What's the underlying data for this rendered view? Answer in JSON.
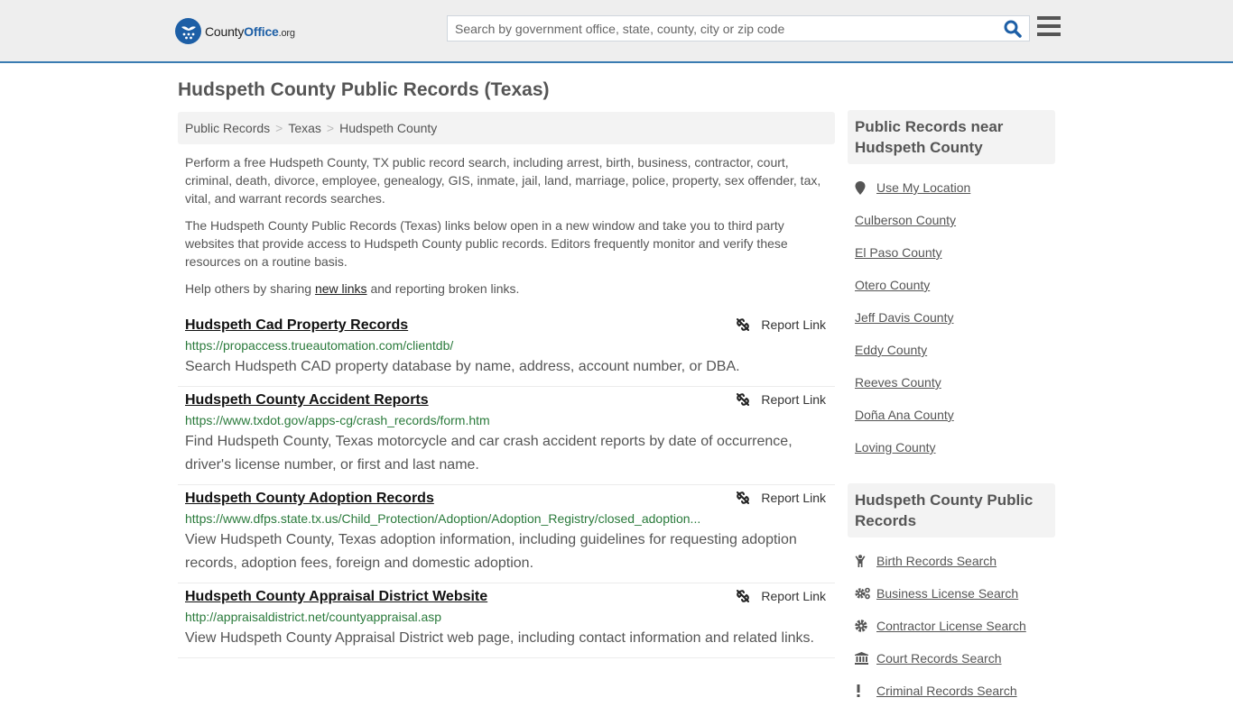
{
  "header": {
    "logo": {
      "part1": "County",
      "part2": "Office",
      "part3": ".org"
    },
    "search_placeholder": "Search by government office, state, county, city or zip code",
    "search_value": "",
    "search_icon": "search-icon",
    "menu_icon": "hamburger-menu-icon",
    "accent_color": "#3a7cb2"
  },
  "page": {
    "title": "Hudspeth County Public Records (Texas)",
    "breadcrumb": [
      "Public Records",
      "Texas",
      "Hudspeth County"
    ],
    "intro": {
      "p1": "Perform a free Hudspeth County, TX public record search, including arrest, birth, business, contractor, court, criminal, death, divorce, employee, genealogy, GIS, inmate, jail, land, marriage, police, property, sex offender, tax, vital, and warrant records searches.",
      "p2": "The Hudspeth County Public Records (Texas) links below open in a new window and take you to third party websites that provide access to Hudspeth County public records. Editors frequently monitor and verify these resources on a routine basis.",
      "p3_before": "Help others by sharing ",
      "p3_link": "new links",
      "p3_after": " and reporting broken links."
    }
  },
  "records": [
    {
      "title": "Hudspeth Cad Property Records",
      "url": "https://propaccess.trueautomation.com/clientdb/",
      "description": "Search Hudspeth CAD property database by name, address, account number, or DBA.",
      "report_label": "Report Link"
    },
    {
      "title": "Hudspeth County Accident Reports",
      "url": "https://www.txdot.gov/apps-cg/crash_records/form.htm",
      "description": "Find Hudspeth County, Texas motorcycle and car crash accident reports by date of occurrence, driver's license number, or first and last name.",
      "report_label": "Report Link"
    },
    {
      "title": "Hudspeth County Adoption Records",
      "url": "https://www.dfps.state.tx.us/Child_Protection/Adoption/Adoption_Registry/closed_adoption...",
      "description": "View Hudspeth County, Texas adoption information, including guidelines for requesting adoption records, adoption fees, foreign and domestic adoption.",
      "report_label": "Report Link"
    },
    {
      "title": "Hudspeth County Appraisal District Website",
      "url": "http://appraisaldistrict.net/countyappraisal.asp",
      "description": "View Hudspeth County Appraisal District web page, including contact information and related links.",
      "report_label": "Report Link"
    }
  ],
  "sidebar": {
    "nearby": {
      "heading": "Public Records near Hudspeth County",
      "use_location": "Use My Location",
      "counties": [
        "Culberson County",
        "El Paso County",
        "Otero County",
        "Jeff Davis County",
        "Eddy County",
        "Reeves County",
        "Doña Ana County",
        "Loving County"
      ]
    },
    "county_records": {
      "heading": "Hudspeth County Public Records",
      "items": [
        {
          "label": "Birth Records Search",
          "icon": "child-icon"
        },
        {
          "label": "Business License Search",
          "icon": "cogs-icon"
        },
        {
          "label": "Contractor License Search",
          "icon": "cog-icon"
        },
        {
          "label": "Court Records Search",
          "icon": "courthouse-icon"
        },
        {
          "label": "Criminal Records Search",
          "icon": "exclamation-icon"
        }
      ]
    }
  }
}
